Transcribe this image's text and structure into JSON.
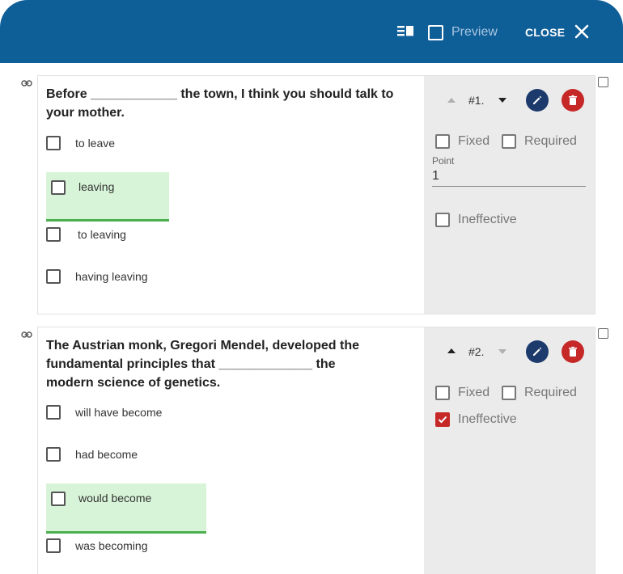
{
  "header": {
    "preview_label": "Preview",
    "close_label": "CLOSE",
    "bg_color": "#0e5e98",
    "icons": [
      "list-view-icon",
      "close-icon"
    ]
  },
  "questions": [
    {
      "text": "Before ____________ the town, I think you should talk to your mother.",
      "number": "#1.",
      "options": [
        {
          "label": "to leave",
          "correct": false
        },
        {
          "label": "leaving",
          "correct": true
        },
        {
          "label": "to leaving",
          "correct": false
        },
        {
          "label": "having leaving",
          "correct": false
        }
      ],
      "fixed_label": "Fixed",
      "required_label": "Required",
      "point_label": "Point",
      "point_value": "1",
      "ineffective_label": "Ineffective",
      "ineffective_checked": false
    },
    {
      "text": "The Austrian monk, Gregori Mendel, developed the fundamental principles that _____________ the modern science of genetics.",
      "number": "#2.",
      "options": [
        {
          "label": "will have become",
          "correct": false
        },
        {
          "label": "had become",
          "correct": false
        },
        {
          "label": "would become",
          "correct": true
        },
        {
          "label": "was becoming",
          "correct": false
        }
      ],
      "fixed_label": "Fixed",
      "required_label": "Required",
      "ineffective_label": "Ineffective",
      "ineffective_checked": true
    }
  ],
  "colors": {
    "correct_bg": "#d8f4d8",
    "correct_border": "#4caf50",
    "edit_button": "#1c3a6b",
    "delete_button": "#c62828"
  }
}
